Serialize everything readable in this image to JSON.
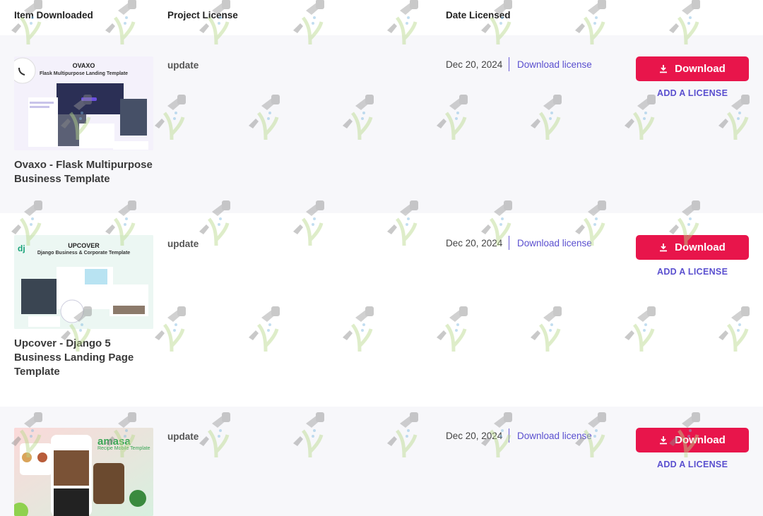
{
  "table": {
    "headers": {
      "item": "Item Downloaded",
      "license": "Project License",
      "date": "Date Licensed"
    }
  },
  "rows": [
    {
      "thumb": {
        "brand": "OVAXO",
        "subtitle": "Flask Multipurpose Landing Template",
        "bg": "#f3f0fb",
        "accent": "#5b3fd6"
      },
      "title": "Ovaxo - Flask Multipurpose Business Template",
      "license": "update",
      "date": "Dec 20, 2024",
      "download_license": "Download license",
      "download_label": "Download",
      "add_license": "ADD A LICENSE"
    },
    {
      "thumb": {
        "brand": "UPCOVER",
        "subtitle": "Django Business & Corporate Template",
        "badge": "dj",
        "bg": "#eaf6f2",
        "accent": "#1aa37a"
      },
      "title": "Upcover - Django 5 Business Landing Page Template",
      "license": "update",
      "date": "Dec 20, 2024",
      "download_license": "Download license",
      "download_label": "Download",
      "add_license": "ADD A LICENSE"
    },
    {
      "thumb": {
        "brand": "amasa",
        "subtitle": "Recipe Mobile Template",
        "bg": "#fbe7e7",
        "accent": "#3aa655"
      },
      "title": "",
      "license": "update",
      "date": "Dec 20, 2024",
      "download_license": "Download license",
      "download_label": "Download",
      "add_license": "ADD A LICENSE"
    }
  ],
  "colors": {
    "primary_button": "#e8154b",
    "link": "#5a4fcf",
    "row_bg": "#f7f7fa"
  }
}
